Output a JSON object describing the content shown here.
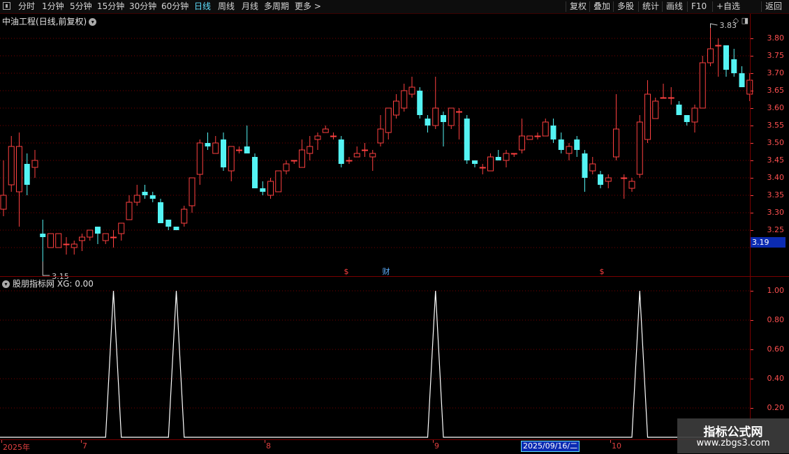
{
  "toolbar": {
    "periods": [
      "分时",
      "1分钟",
      "5分钟",
      "15分钟",
      "30分钟",
      "60分钟",
      "日线",
      "周线",
      "月线",
      "多周期",
      "更多 >"
    ],
    "active_period": "日线",
    "actions": [
      "复权",
      "叠加",
      "多股",
      "统计",
      "画线",
      "F10",
      "+自选",
      "返回"
    ]
  },
  "stock": {
    "name": "中油工程",
    "period_label": "(日线,前复权)"
  },
  "price_axis": {
    "labels": [
      "3.80",
      "3.75",
      "3.70",
      "3.65",
      "3.60",
      "3.55",
      "3.50",
      "3.45",
      "3.40",
      "3.35",
      "3.30",
      "3.25"
    ],
    "current": "3.19"
  },
  "annotations": {
    "high": "3.83",
    "low": "3.15",
    "events": [
      "$",
      "财",
      "$"
    ]
  },
  "indicator": {
    "title": "股朋指标网",
    "value_text": "XG: 0.00",
    "axis_labels": [
      "1.00",
      "0.80",
      "0.60",
      "0.40",
      "0.20"
    ]
  },
  "dates": {
    "labels": [
      "2025年",
      "7",
      "8",
      "9",
      "10"
    ],
    "cursor": "2025/09/16/二"
  },
  "watermark": {
    "title": "指标公式网",
    "url": "www.zbgs3.com"
  },
  "colors": {
    "up": "#ff4040",
    "down": "#54f4f4",
    "grid": "#7a0000",
    "cursor_bg": "#0b2bb2"
  },
  "chart_data": {
    "type": "candlestick",
    "ylim": [
      3.15,
      3.83
    ],
    "candles": [
      [
        3.31,
        3.35,
        3.45,
        3.29
      ],
      [
        3.38,
        3.49,
        3.52,
        3.36
      ],
      [
        3.36,
        3.49,
        3.53,
        3.26
      ],
      [
        3.44,
        3.38,
        3.47,
        3.35
      ],
      [
        3.43,
        3.45,
        3.48,
        3.4
      ],
      [
        3.24,
        3.23,
        3.28,
        3.16
      ],
      [
        3.2,
        3.24,
        3.24,
        3.2
      ],
      [
        3.2,
        3.24,
        3.24,
        3.2
      ],
      [
        3.21,
        3.21,
        3.23,
        3.18
      ],
      [
        3.2,
        3.21,
        3.22,
        3.18
      ],
      [
        3.22,
        3.23,
        3.24,
        3.19
      ],
      [
        3.23,
        3.25,
        3.25,
        3.22
      ],
      [
        3.26,
        3.24,
        3.26,
        3.21
      ],
      [
        3.22,
        3.24,
        3.24,
        3.21
      ],
      [
        3.23,
        3.23,
        3.25,
        3.2
      ],
      [
        3.24,
        3.27,
        3.27,
        3.22
      ],
      [
        3.28,
        3.33,
        3.35,
        3.28
      ],
      [
        3.33,
        3.35,
        3.38,
        3.32
      ],
      [
        3.36,
        3.35,
        3.38,
        3.34
      ],
      [
        3.35,
        3.34,
        3.36,
        3.33
      ],
      [
        3.33,
        3.27,
        3.34,
        3.27
      ],
      [
        3.28,
        3.26,
        3.28,
        3.25
      ],
      [
        3.26,
        3.25,
        3.26,
        3.25
      ],
      [
        3.27,
        3.31,
        3.32,
        3.26
      ],
      [
        3.32,
        3.4,
        3.4,
        3.3
      ],
      [
        3.41,
        3.5,
        3.51,
        3.38
      ],
      [
        3.5,
        3.49,
        3.53,
        3.48
      ],
      [
        3.47,
        3.5,
        3.52,
        3.47
      ],
      [
        3.51,
        3.43,
        3.53,
        3.42
      ],
      [
        3.42,
        3.49,
        3.49,
        3.39
      ],
      [
        3.48,
        3.48,
        3.49,
        3.47
      ],
      [
        3.49,
        3.47,
        3.55,
        3.47
      ],
      [
        3.46,
        3.37,
        3.47,
        3.37
      ],
      [
        3.37,
        3.36,
        3.39,
        3.35
      ],
      [
        3.35,
        3.39,
        3.4,
        3.34
      ],
      [
        3.36,
        3.42,
        3.42,
        3.36
      ],
      [
        3.42,
        3.44,
        3.45,
        3.41
      ],
      [
        3.45,
        3.45,
        3.45,
        3.44
      ],
      [
        3.43,
        3.48,
        3.51,
        3.43
      ],
      [
        3.47,
        3.49,
        3.52,
        3.45
      ],
      [
        3.51,
        3.52,
        3.53,
        3.48
      ],
      [
        3.53,
        3.54,
        3.55,
        3.53
      ],
      [
        3.52,
        3.52,
        3.53,
        3.51
      ],
      [
        3.51,
        3.44,
        3.52,
        3.43
      ],
      [
        3.45,
        3.45,
        3.46,
        3.44
      ],
      [
        3.46,
        3.47,
        3.49,
        3.46
      ],
      [
        3.48,
        3.48,
        3.5,
        3.46
      ],
      [
        3.46,
        3.47,
        3.48,
        3.42
      ],
      [
        3.5,
        3.54,
        3.58,
        3.49
      ],
      [
        3.53,
        3.6,
        3.6,
        3.51
      ],
      [
        3.58,
        3.62,
        3.64,
        3.57
      ],
      [
        3.6,
        3.65,
        3.67,
        3.59
      ],
      [
        3.64,
        3.66,
        3.69,
        3.63
      ],
      [
        3.65,
        3.58,
        3.66,
        3.57
      ],
      [
        3.57,
        3.55,
        3.58,
        3.53
      ],
      [
        3.55,
        3.6,
        3.69,
        3.54
      ],
      [
        3.58,
        3.56,
        3.59,
        3.49
      ],
      [
        3.55,
        3.6,
        3.6,
        3.54
      ],
      [
        3.59,
        3.59,
        3.6,
        3.51
      ],
      [
        3.57,
        3.45,
        3.58,
        3.44
      ],
      [
        3.45,
        3.44,
        3.45,
        3.43
      ],
      [
        3.43,
        3.43,
        3.44,
        3.41
      ],
      [
        3.42,
        3.46,
        3.47,
        3.42
      ],
      [
        3.46,
        3.45,
        3.48,
        3.45
      ],
      [
        3.45,
        3.47,
        3.48,
        3.43
      ],
      [
        3.47,
        3.47,
        3.47,
        3.46
      ],
      [
        3.48,
        3.52,
        3.57,
        3.47
      ],
      [
        3.51,
        3.52,
        3.52,
        3.51
      ],
      [
        3.52,
        3.52,
        3.53,
        3.51
      ],
      [
        3.52,
        3.56,
        3.57,
        3.52
      ],
      [
        3.55,
        3.51,
        3.57,
        3.5
      ],
      [
        3.51,
        3.48,
        3.53,
        3.47
      ],
      [
        3.47,
        3.49,
        3.5,
        3.45
      ],
      [
        3.51,
        3.48,
        3.52,
        3.46
      ],
      [
        3.47,
        3.4,
        3.48,
        3.36
      ],
      [
        3.42,
        3.44,
        3.46,
        3.41
      ],
      [
        3.41,
        3.38,
        3.42,
        3.37
      ],
      [
        3.39,
        3.4,
        3.41,
        3.37
      ],
      [
        3.46,
        3.54,
        3.64,
        3.45
      ],
      [
        3.4,
        3.4,
        3.41,
        3.34
      ],
      [
        3.37,
        3.39,
        3.4,
        3.36
      ],
      [
        3.41,
        3.56,
        3.58,
        3.4
      ],
      [
        3.51,
        3.64,
        3.68,
        3.5
      ],
      [
        3.57,
        3.62,
        3.63,
        3.57
      ],
      [
        3.63,
        3.63,
        3.67,
        3.63
      ],
      [
        3.63,
        3.63,
        3.66,
        3.61
      ],
      [
        3.61,
        3.58,
        3.62,
        3.58
      ],
      [
        3.58,
        3.56,
        3.58,
        3.55
      ],
      [
        3.56,
        3.6,
        3.61,
        3.53
      ],
      [
        3.6,
        3.73,
        3.75,
        3.6
      ],
      [
        3.73,
        3.77,
        3.83,
        3.72
      ],
      [
        3.78,
        3.78,
        3.8,
        3.69
      ],
      [
        3.78,
        3.71,
        3.78,
        3.69
      ],
      [
        3.74,
        3.7,
        3.77,
        3.69
      ],
      [
        3.7,
        3.66,
        3.72,
        3.66
      ],
      [
        3.64,
        3.68,
        3.7,
        3.62
      ]
    ],
    "indicator": {
      "name": "XG",
      "ylim": [
        0,
        1.0
      ],
      "peak_bars": [
        14,
        22,
        55,
        81
      ]
    }
  }
}
